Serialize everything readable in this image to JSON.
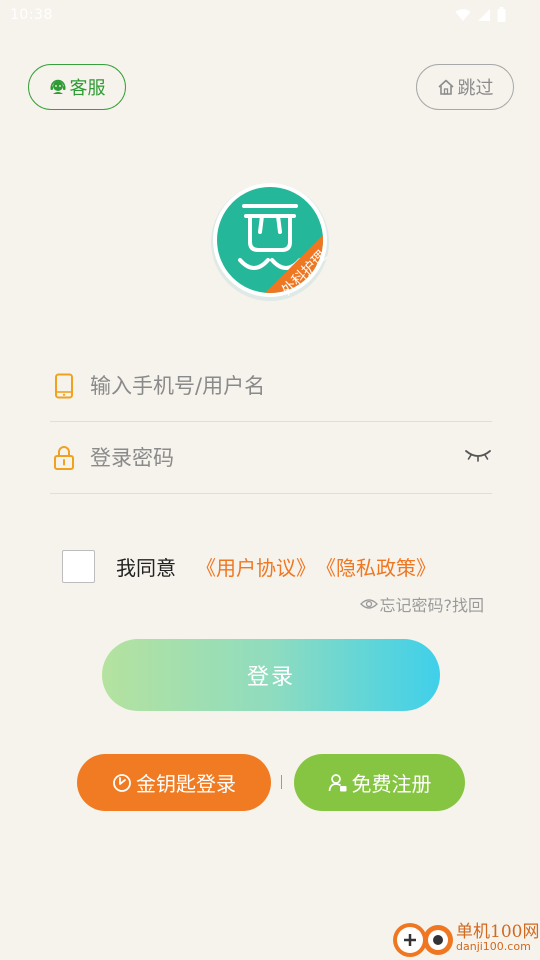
{
  "status_bar": {
    "time": "10:38"
  },
  "header": {
    "service_label": "客服",
    "skip_label": "跳过"
  },
  "logo": {
    "badge_text": "外科护理",
    "brand_color": "#25b79a",
    "badge_color": "#f07722"
  },
  "form": {
    "phone_placeholder": "输入手机号/用户名",
    "phone_value": "",
    "password_placeholder": "登录密码",
    "password_value": ""
  },
  "agreement": {
    "prefix": "我同意",
    "user_agreement": "《用户协议》",
    "privacy_policy": "《隐私政策》",
    "checked": false
  },
  "forgot": {
    "label": "忘记密码?找回"
  },
  "login": {
    "label": "登录"
  },
  "alt_actions": {
    "golden_key_label": "金钥匙登录",
    "register_label": "免费注册"
  },
  "watermark": {
    "name": "单机100网",
    "url": "danji100.com"
  },
  "colors": {
    "accent_orange": "#f07722",
    "accent_green": "#86c541",
    "service_green": "#39a13c",
    "background": "#f6f3ec"
  }
}
